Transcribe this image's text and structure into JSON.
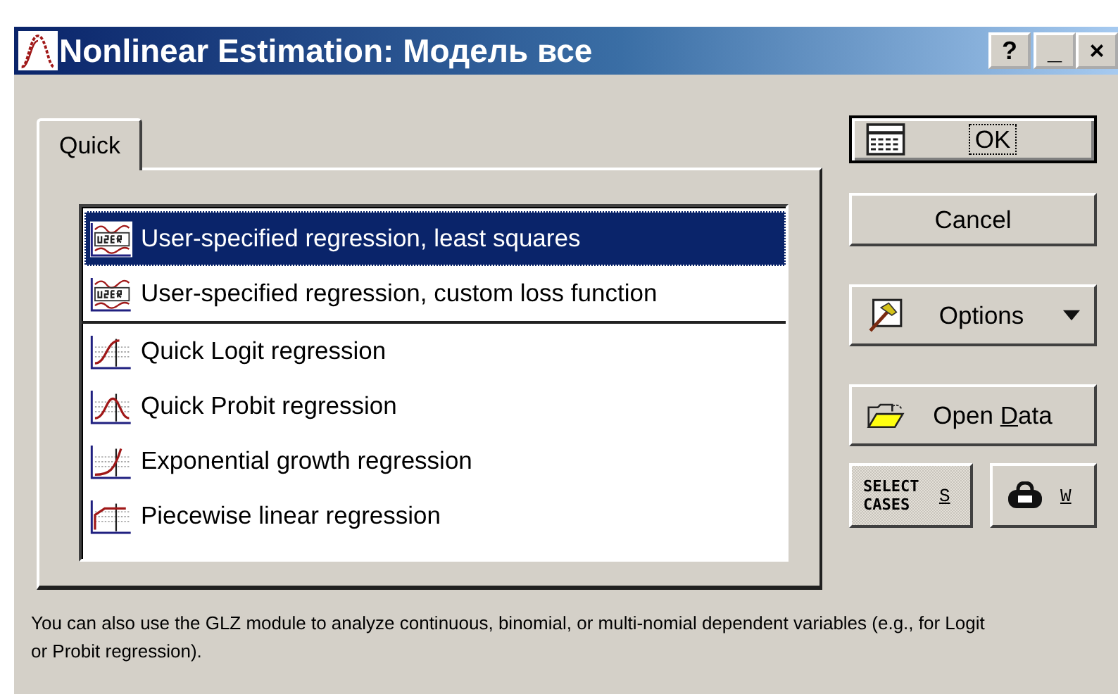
{
  "window": {
    "title": "Nonlinear Estimation: Модель все",
    "controls": [
      "?",
      "_",
      "×"
    ]
  },
  "tabs": [
    {
      "label": "Quick",
      "selected": true
    }
  ],
  "list": [
    {
      "kind": "user",
      "label": "User-specified regression, least squares",
      "selected": true,
      "separator_after": false
    },
    {
      "kind": "user",
      "label": "User-specified regression, custom loss function",
      "selected": false,
      "separator_after": true
    },
    {
      "kind": "logit",
      "label": "Quick Logit regression",
      "selected": false,
      "separator_after": false
    },
    {
      "kind": "probit",
      "label": "Quick Probit regression",
      "selected": false,
      "separator_after": false
    },
    {
      "kind": "exponential",
      "label": "Exponential growth regression",
      "selected": false,
      "separator_after": false
    },
    {
      "kind": "piecewise",
      "label": "Piecewise linear regression",
      "selected": false,
      "separator_after": false
    }
  ],
  "buttons": [
    {
      "kind": "ok",
      "label": "OK"
    },
    {
      "kind": "cancel",
      "label": "Cancel"
    },
    {
      "kind": "options",
      "label": "Options"
    },
    {
      "kind": "open",
      "label": "Open ",
      "accel": "D",
      "rest": "ata"
    }
  ],
  "small_buttons": [
    {
      "kind": "select",
      "label": "SELECT CASES",
      "accel": "S"
    },
    {
      "kind": "weight",
      "accel": "W"
    }
  ],
  "note": "You can also use the GLZ module to analyze continuous, binomial, or multi-nomial dependent variables (e.g., for Logit or Probit regression)."
}
